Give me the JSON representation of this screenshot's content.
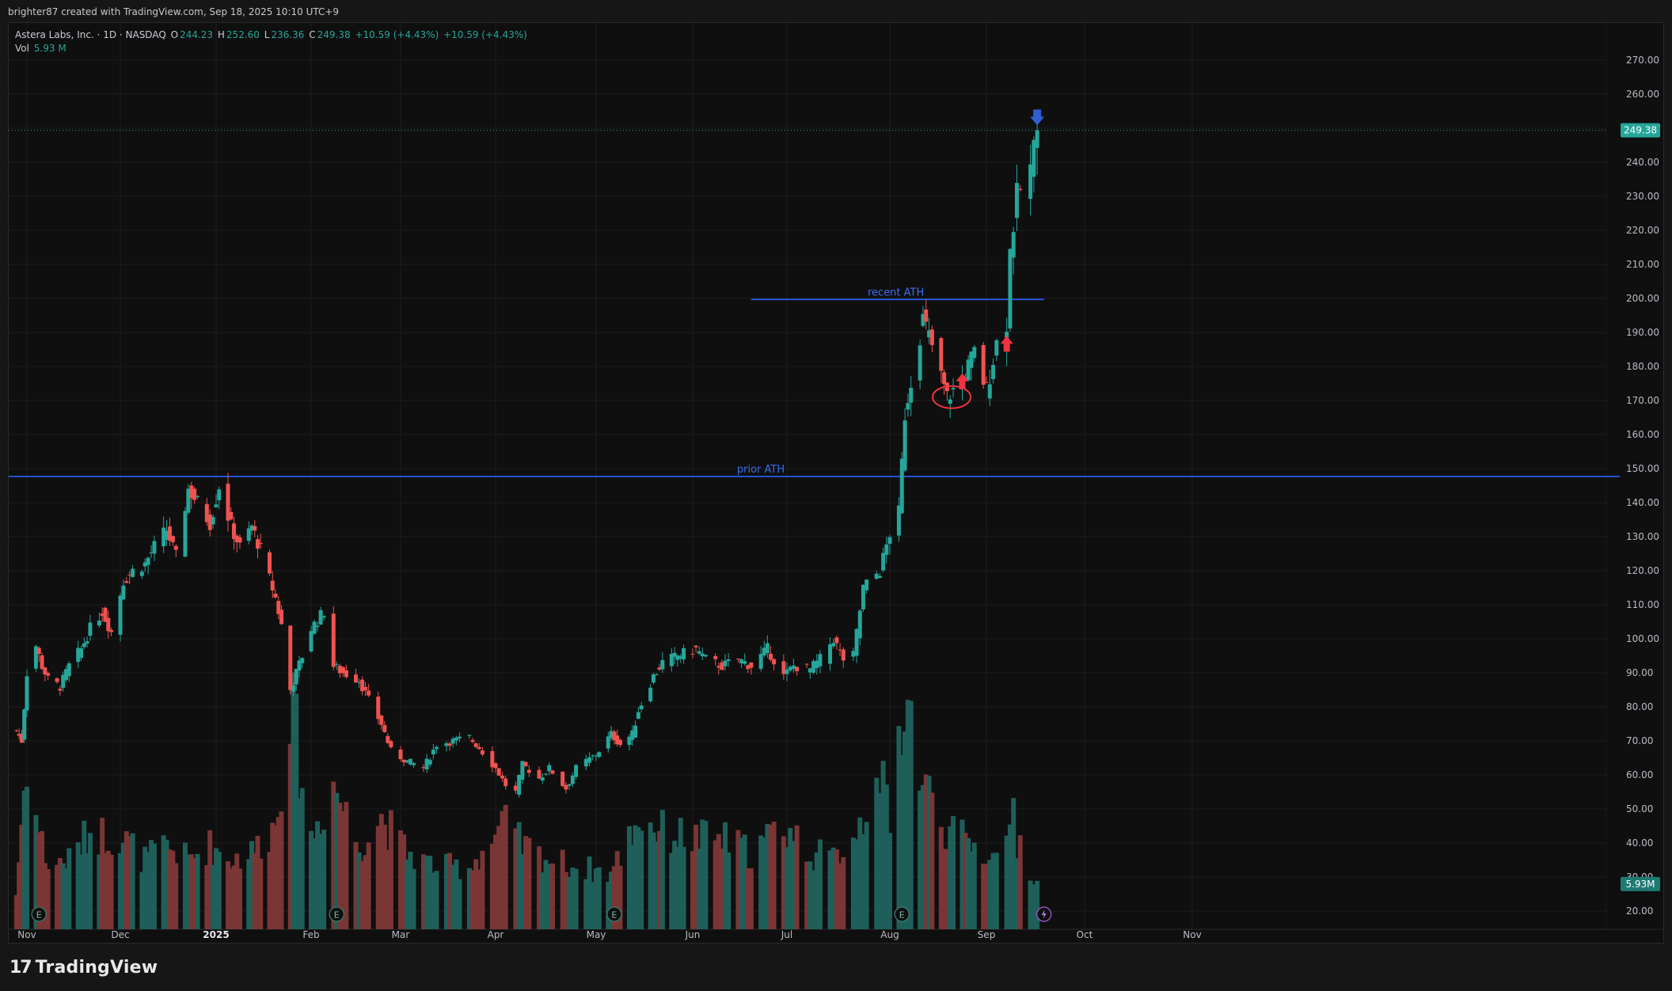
{
  "attribution": "brighter87 created with TradingView.com, Sep 18, 2025 10:10 UTC+9",
  "legend": {
    "name": "Astera Labs, Inc. · 1D · NASDAQ",
    "o_label": "O",
    "o": "244.23",
    "h_label": "H",
    "h": "252.60",
    "l_label": "L",
    "l": "236.36",
    "c_label": "C",
    "c": "249.38",
    "change": "+10.59 (+4.43%)",
    "change2": "+10.59 (+4.43%)",
    "vol_label": "Vol",
    "vol": "5.93 M"
  },
  "logo": {
    "mark": "17",
    "text": "TradingView"
  },
  "colors": {
    "up": "#26a69a",
    "down": "#ef5350",
    "up_vol": "#1f5f5a",
    "down_vol": "#7a3535",
    "line": "#2962ff",
    "annotation": "#ef3340",
    "arrow_down": "#2f5fd0",
    "bg": "#0f0f0f"
  },
  "chart_data": {
    "type": "candlestick",
    "title": "Astera Labs, Inc. · 1D · NASDAQ",
    "ylim": [
      15,
      276
    ],
    "yticks": [
      "270.00",
      "260.00",
      "250.00",
      "240.00",
      "230.00",
      "220.00",
      "210.00",
      "200.00",
      "190.00",
      "180.00",
      "170.00",
      "160.00",
      "150.00",
      "140.00",
      "130.00",
      "120.00",
      "110.00",
      "100.00",
      "90.00",
      "80.00",
      "70.00",
      "60.00",
      "50.00",
      "40.00",
      "30.00",
      "20.00"
    ],
    "xticks": [
      "Nov",
      "Dec",
      "2025",
      "Feb",
      "Mar",
      "Apr",
      "May",
      "Jun",
      "Jul",
      "Aug",
      "Sep",
      "Oct",
      "Nov"
    ],
    "last_price_label": "249.38",
    "last_volume_label": "5.93M",
    "grid": true,
    "levels": [
      {
        "label": "prior ATH",
        "value": 147.7
      },
      {
        "label": "recent ATH",
        "value": 199.7
      }
    ],
    "price_path": [
      [
        "Oct 28",
        73
      ],
      [
        "Oct 30",
        70
      ],
      [
        "Nov 1",
        90
      ],
      [
        "Nov 4",
        98
      ],
      [
        "Nov 6",
        92
      ],
      [
        "Nov 8",
        88
      ],
      [
        "Nov 12",
        86
      ],
      [
        "Nov 15",
        92
      ],
      [
        "Nov 19",
        97
      ],
      [
        "Nov 22",
        103
      ],
      [
        "Nov 26",
        108
      ],
      [
        "Nov 29",
        102
      ],
      [
        "Dec 3",
        117
      ],
      [
        "Dec 6",
        120
      ],
      [
        "Dec 10",
        122
      ],
      [
        "Dec 13",
        127
      ],
      [
        "Dec 17",
        132
      ],
      [
        "Dec 20",
        124
      ],
      [
        "Dec 24",
        144
      ],
      [
        "Dec 27",
        140
      ],
      [
        "Dec 31",
        134
      ],
      [
        "Jan 3",
        145
      ],
      [
        "Jan 7",
        133
      ],
      [
        "Jan 10",
        127
      ],
      [
        "Jan 14",
        133
      ],
      [
        "Jan 17",
        126
      ],
      [
        "Jan 22",
        112
      ],
      [
        "Jan 24",
        104
      ],
      [
        "Jan 27",
        85
      ],
      [
        "Jan 31",
        95
      ],
      [
        "Feb 3",
        103
      ],
      [
        "Feb 7",
        108
      ],
      [
        "Feb 10",
        92
      ],
      [
        "Feb 13",
        90
      ],
      [
        "Feb 18",
        88
      ],
      [
        "Feb 21",
        82
      ],
      [
        "Feb 25",
        75
      ],
      [
        "Feb 28",
        67
      ],
      [
        "Mar 5",
        64
      ],
      [
        "Mar 10",
        62
      ],
      [
        "Mar 14",
        69
      ],
      [
        "Mar 19",
        70
      ],
      [
        "Mar 24",
        71
      ],
      [
        "Mar 27",
        68
      ],
      [
        "Apr 1",
        62
      ],
      [
        "Apr 4",
        57
      ],
      [
        "Apr 7",
        55
      ],
      [
        "Apr 9",
        63
      ],
      [
        "Apr 14",
        59
      ],
      [
        "Apr 17",
        62
      ],
      [
        "Apr 22",
        56
      ],
      [
        "Apr 25",
        62
      ],
      [
        "May 1",
        66
      ],
      [
        "May 6",
        72
      ],
      [
        "May 9",
        69
      ],
      [
        "May 13",
        72
      ],
      [
        "May 15",
        79
      ],
      [
        "May 20",
        89
      ],
      [
        "May 23",
        93
      ],
      [
        "May 28",
        95
      ],
      [
        "Jun 3",
        97
      ],
      [
        "Jun 6",
        94
      ],
      [
        "Jun 11",
        92
      ],
      [
        "Jun 16",
        94
      ],
      [
        "Jun 20",
        92
      ],
      [
        "Jun 25",
        97
      ],
      [
        "Jun 30",
        89
      ],
      [
        "Jul 3",
        92
      ],
      [
        "Jul 8",
        91
      ],
      [
        "Jul 11",
        94
      ],
      [
        "Jul 15",
        100
      ],
      [
        "Jul 18",
        94
      ],
      [
        "Jul 21",
        95
      ],
      [
        "Jul 24",
        115
      ],
      [
        "Jul 29",
        120
      ],
      [
        "Aug 1",
        131
      ],
      [
        "Aug 4",
        137
      ],
      [
        "Aug 6",
        166
      ],
      [
        "Aug 8",
        176
      ],
      [
        "Aug 12",
        194
      ],
      [
        "Aug 15",
        186
      ],
      [
        "Aug 20",
        171
      ],
      [
        "Aug 25",
        176
      ],
      [
        "Aug 29",
        184
      ],
      [
        "Sep 2",
        173
      ],
      [
        "Sep 5",
        187
      ],
      [
        "Sep 8",
        193
      ],
      [
        "Sep 9",
        214
      ],
      [
        "Sep 11",
        230
      ],
      [
        "Sep 15",
        238
      ],
      [
        "Sep 17",
        249.38
      ]
    ],
    "volume_path_millions": [
      [
        "Oct 28",
        4
      ],
      [
        "Nov 1",
        24
      ],
      [
        "Nov 4",
        15
      ],
      [
        "Nov 8",
        8
      ],
      [
        "Nov 15",
        9
      ],
      [
        "Nov 22",
        13
      ],
      [
        "Dec 3",
        12
      ],
      [
        "Dec 10",
        9
      ],
      [
        "Dec 17",
        11
      ],
      [
        "Dec 24",
        9
      ],
      [
        "Dec 31",
        11
      ],
      [
        "Jan 7",
        9
      ],
      [
        "Jan 14",
        10
      ],
      [
        "Jan 22",
        14
      ],
      [
        "Jan 27",
        32
      ],
      [
        "Feb 3",
        12
      ],
      [
        "Feb 10",
        20
      ],
      [
        "Feb 18",
        11
      ],
      [
        "Feb 25",
        15
      ],
      [
        "Mar 5",
        10
      ],
      [
        "Mar 14",
        8
      ],
      [
        "Mar 24",
        8
      ],
      [
        "Apr 4",
        14
      ],
      [
        "Apr 9",
        11
      ],
      [
        "Apr 17",
        9
      ],
      [
        "Apr 25",
        8
      ],
      [
        "May 6",
        7
      ],
      [
        "May 15",
        15
      ],
      [
        "May 23",
        13
      ],
      [
        "Jun 3",
        12
      ],
      [
        "Jun 11",
        12
      ],
      [
        "Jun 20",
        10
      ],
      [
        "Jun 30",
        14
      ],
      [
        "Jul 8",
        10
      ],
      [
        "Jul 15",
        9
      ],
      [
        "Jul 24",
        15
      ],
      [
        "Jul 28",
        25
      ],
      [
        "Aug 1",
        13
      ],
      [
        "Aug 6",
        34
      ],
      [
        "Aug 12",
        20
      ],
      [
        "Aug 20",
        13
      ],
      [
        "Aug 29",
        11
      ],
      [
        "Sep 5",
        9
      ],
      [
        "Sep 9",
        17
      ],
      [
        "Sep 11",
        12
      ],
      [
        "Sep 17",
        5.93
      ]
    ]
  }
}
